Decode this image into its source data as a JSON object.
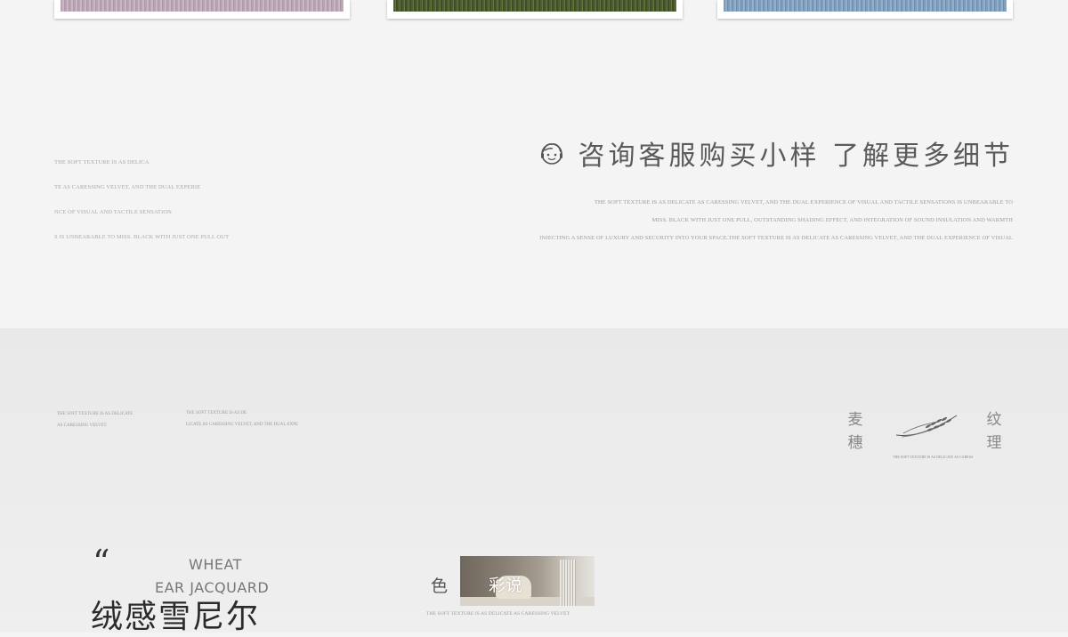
{
  "swatches": [
    {
      "name": "lilac"
    },
    {
      "name": "olive"
    },
    {
      "name": "sky-blue"
    }
  ],
  "left_text_lines": [
    "THE SOFT TEXTURE IS AS DELICA",
    "TE AS CARESSING VELVET, AND THE DUAL EXPERIE",
    "NCE OF VISUAL AND TACTILE SENSATION",
    "S IS UNBEARABLE TO MISS. BLACK WITH JUST ONE PULL OUT"
  ],
  "headline": {
    "icon": "customer-service-face-icon",
    "text": "咨询客服购买小样 了解更多细节"
  },
  "description_lines": [
    "THE SOFT TEXTURE IS AS DELICATE AS CARESSING VELVET, AND THE DUAL EXPERIENCE OF VISUAL AND TACTILE SENSATIONS IS UNBEARABLE TO",
    "MISS. BLACK WITH JUST ONE PULL, OUTSTANDING SHADING EFFECT, AND INTEGRATION OF SOUND INSULATION AND WARMTH",
    "INJECTING A SENSE OF LUXURY AND SECURITY INTO YOUR SPACE.THE SOFT TEXTURE IS AS DELICATE AS CARESSING VELVET, AND THE DUAL EXPERIENCE OF VISUAL"
  ],
  "band": {
    "mini_left": [
      "THE SOFT TEXTURE IS AS DELICATE",
      "AS CARESSING VELVET."
    ],
    "mini_mid": [
      "THE SOFT TEXTURE IS AS DE",
      "LICATE AS CARESSING VELVET, AND THE DUAL EXPE"
    ],
    "vertical_left": [
      "麦",
      "穗"
    ],
    "vertical_right": [
      "纹",
      "理"
    ],
    "wheat_icon": "wheat-icon",
    "wheat_caption": "THE SOFT TEXTURE IS AS DELICATE AS CARESS"
  },
  "bottom": {
    "quote": "“",
    "en_line1": "WHEAT",
    "en_line2": "EAR JACQUARD",
    "cn_title": "绒感雪尼尔",
    "color_label": "色",
    "photo_title": "彩说",
    "photo_caption": "THE SOFT TEXTURE IS AS DELICATE AS CARESSING VELVET"
  }
}
